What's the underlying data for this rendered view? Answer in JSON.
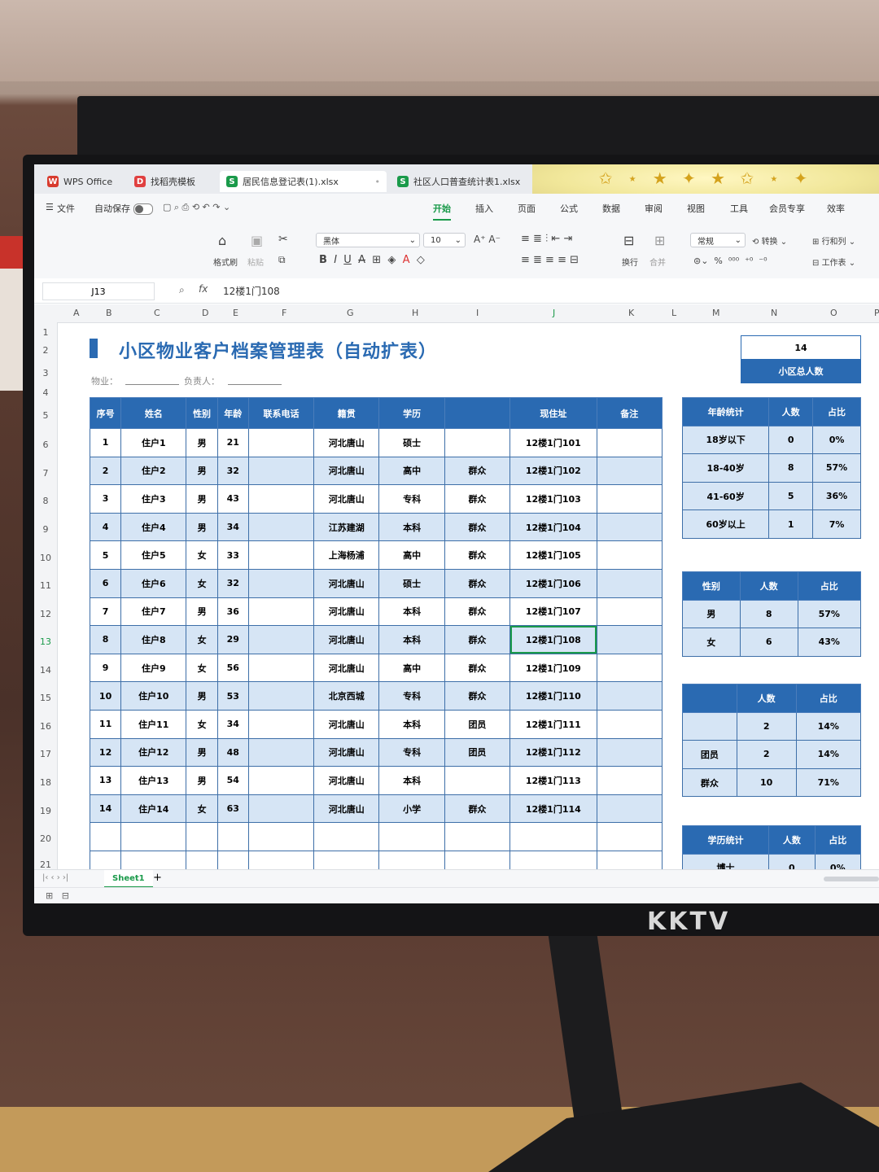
{
  "tabs": [
    {
      "label": "WPS Office",
      "icon": "wps-logo-icon",
      "color": "#d83b2e"
    },
    {
      "label": "找稻壳模板",
      "icon": "docer-icon",
      "color": "#e04040"
    },
    {
      "label": "居民信息登记表(1).xlsx",
      "icon": "spreadsheet-icon",
      "color": "#1a9a4a"
    },
    {
      "label": "社区人口普查统计表1.xlsx",
      "icon": "spreadsheet-icon",
      "color": "#1a9a4a"
    }
  ],
  "menu": {
    "file": "文件",
    "autosave": "自动保存",
    "items": [
      "开始",
      "插入",
      "页面",
      "公式",
      "数据",
      "审阅",
      "视图",
      "工具",
      "会员专享",
      "效率"
    ],
    "active": "开始"
  },
  "toolbar": {
    "format_painter": "格式刷",
    "paste": "粘贴",
    "font": "黑体",
    "size": "10",
    "wrap": "换行",
    "merge": "合并",
    "number_format": "常规",
    "convert": "转换",
    "rows_cols": "行和列",
    "worksheet": "工作表"
  },
  "formula": {
    "cell_ref": "J13",
    "fx": "fx",
    "value": "12楼1门108"
  },
  "columns": [
    "A",
    "B",
    "C",
    "D",
    "E",
    "F",
    "G",
    "H",
    "I",
    "J",
    "K",
    "L",
    "M",
    "N",
    "O",
    "P"
  ],
  "rows": [
    "1",
    "2",
    "3",
    "4",
    "5",
    "6",
    "7",
    "8",
    "9",
    "10",
    "11",
    "12",
    "13",
    "14",
    "15",
    "16",
    "17",
    "18",
    "19",
    "20",
    "21"
  ],
  "sheet": {
    "title": "小区物业客户档案管理表（自动扩表）",
    "property_label": "物业：",
    "owner_label": "负责人：",
    "total_value": "14",
    "total_label": "小区总人数"
  },
  "main_table": {
    "headers": [
      "序号",
      "姓名",
      "性别",
      "年龄",
      "联系电话",
      "籍贯",
      "学历",
      "",
      "现住址",
      "备注"
    ],
    "rows": [
      [
        "1",
        "住户1",
        "男",
        "21",
        "",
        "河北唐山",
        "硕士",
        "",
        "12楼1门101",
        ""
      ],
      [
        "2",
        "住户2",
        "男",
        "32",
        "",
        "河北唐山",
        "高中",
        "群众",
        "12楼1门102",
        ""
      ],
      [
        "3",
        "住户3",
        "男",
        "43",
        "",
        "河北唐山",
        "专科",
        "群众",
        "12楼1门103",
        ""
      ],
      [
        "4",
        "住户4",
        "男",
        "34",
        "",
        "江苏建湖",
        "本科",
        "群众",
        "12楼1门104",
        ""
      ],
      [
        "5",
        "住户5",
        "女",
        "33",
        "",
        "上海杨浦",
        "高中",
        "群众",
        "12楼1门105",
        ""
      ],
      [
        "6",
        "住户6",
        "女",
        "32",
        "",
        "河北唐山",
        "硕士",
        "群众",
        "12楼1门106",
        ""
      ],
      [
        "7",
        "住户7",
        "男",
        "36",
        "",
        "河北唐山",
        "本科",
        "群众",
        "12楼1门107",
        ""
      ],
      [
        "8",
        "住户8",
        "女",
        "29",
        "",
        "河北唐山",
        "本科",
        "群众",
        "12楼1门108",
        ""
      ],
      [
        "9",
        "住户9",
        "女",
        "56",
        "",
        "河北唐山",
        "高中",
        "群众",
        "12楼1门109",
        ""
      ],
      [
        "10",
        "住户10",
        "男",
        "53",
        "",
        "北京西城",
        "专科",
        "群众",
        "12楼1门110",
        ""
      ],
      [
        "11",
        "住户11",
        "女",
        "34",
        "",
        "河北唐山",
        "本科",
        "团员",
        "12楼1门111",
        ""
      ],
      [
        "12",
        "住户12",
        "男",
        "48",
        "",
        "河北唐山",
        "专科",
        "团员",
        "12楼1门112",
        ""
      ],
      [
        "13",
        "住户13",
        "男",
        "54",
        "",
        "河北唐山",
        "本科",
        "",
        "12楼1门113",
        ""
      ],
      [
        "14",
        "住户14",
        "女",
        "63",
        "",
        "河北唐山",
        "小学",
        "群众",
        "12楼1门114",
        ""
      ]
    ]
  },
  "age_stats": {
    "headers": [
      "年龄统计",
      "人数",
      "占比"
    ],
    "rows": [
      [
        "18岁以下",
        "0",
        "0%"
      ],
      [
        "18-40岁",
        "8",
        "57%"
      ],
      [
        "41-60岁",
        "5",
        "36%"
      ],
      [
        "60岁以上",
        "1",
        "7%"
      ]
    ]
  },
  "gender_stats": {
    "headers": [
      "性别",
      "人数",
      "占比"
    ],
    "rows": [
      [
        "男",
        "8",
        "57%"
      ],
      [
        "女",
        "6",
        "43%"
      ]
    ]
  },
  "political_stats": {
    "headers": [
      "",
      "人数",
      "占比"
    ],
    "rows": [
      [
        "",
        "2",
        "14%"
      ],
      [
        "团员",
        "2",
        "14%"
      ],
      [
        "群众",
        "10",
        "71%"
      ]
    ]
  },
  "edu_stats": {
    "headers": [
      "学历统计",
      "人数",
      "占比"
    ],
    "rows": [
      [
        "博士",
        "0",
        "0%"
      ]
    ]
  },
  "sheet_tab": "Sheet1",
  "monitor_brand": "KKTV",
  "colors": {
    "accent": "#2a6ab2",
    "stripe": "#d6e5f5",
    "wps_green": "#1a9a4a"
  }
}
